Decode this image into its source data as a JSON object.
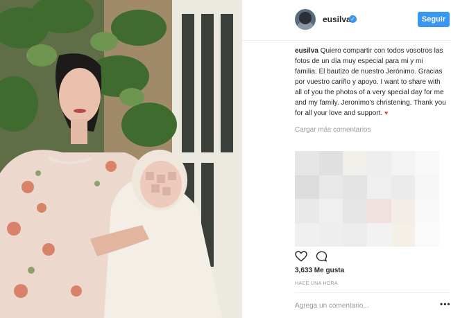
{
  "post": {
    "username": "eusilva",
    "follow_label": "Seguir",
    "caption_user": "eusilva",
    "caption_text": "Quiero compartir con todos vosotros las fotos de un día muy especial para mi y mi familia. El bautizo de nuestro Jerónimo. Gracias por vuestro cariño y apoyo. I want to share with all of you the photos of a very special day for me and my family. Jeronimo's christening. Thank you for all your love and support.",
    "caption_end": "♥",
    "load_more": "Cargar más comentarios",
    "likes": "3,633 Me gusta",
    "time": "HACE UNA HORA",
    "add_comment_placeholder": "Agrega un comentario...",
    "more_icon": "•••"
  },
  "icons": [
    "verified-badge-icon",
    "heart-icon",
    "comment-icon",
    "more-options-icon"
  ],
  "colors": {
    "accent": "#3897f0",
    "heart": "#ed4956",
    "muted": "#999999"
  }
}
